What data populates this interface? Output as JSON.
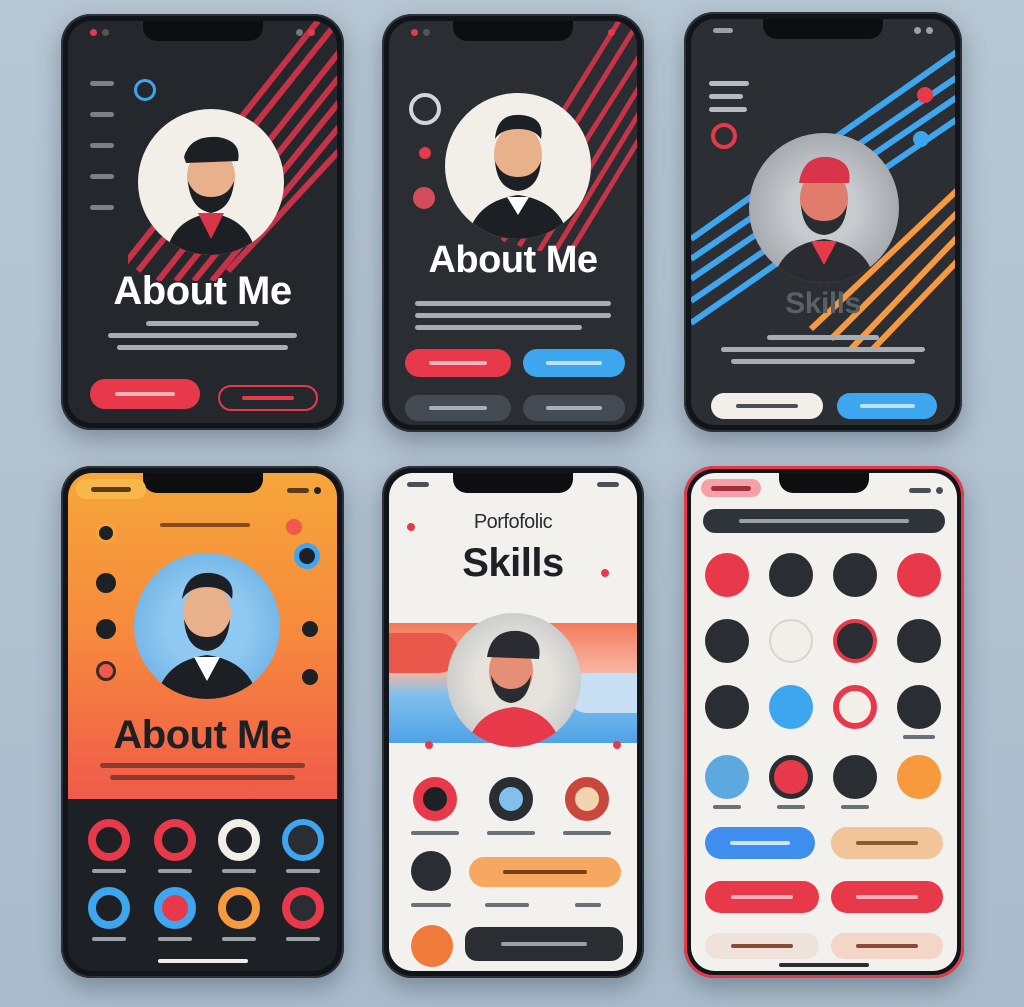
{
  "phones": [
    {
      "id": "about-dark",
      "title": "About Me"
    },
    {
      "id": "about-dark-2",
      "title": "About Me"
    },
    {
      "id": "skills-dark",
      "title": "Skills"
    },
    {
      "id": "about-orange",
      "title": "About Me"
    },
    {
      "id": "skills-light",
      "eyebrow": "Porfofolic",
      "title": "Skills"
    },
    {
      "id": "icons-grid",
      "title": ""
    }
  ],
  "colors": {
    "accent_red": "#e8394b",
    "accent_blue": "#3ea5ef",
    "accent_orange": "#f79a3e",
    "dark_bg": "#23272c",
    "light_bg": "#f3f1ee"
  }
}
